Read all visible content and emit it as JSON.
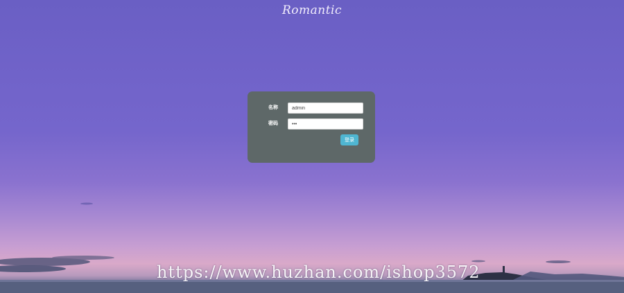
{
  "brand": {
    "title": "Romantic"
  },
  "login_form": {
    "username": {
      "label": "名称",
      "value": "admin"
    },
    "password": {
      "label": "密码",
      "value": "•••"
    },
    "submit_label": "登录"
  },
  "watermark": "https://www.huzhan.com/ishop3572",
  "colors": {
    "sky_top": "#6a5fc4",
    "sky_horizon": "#d9a9c9",
    "panel_bg": "#5e6868",
    "button_bg": "#4fb6d2"
  }
}
